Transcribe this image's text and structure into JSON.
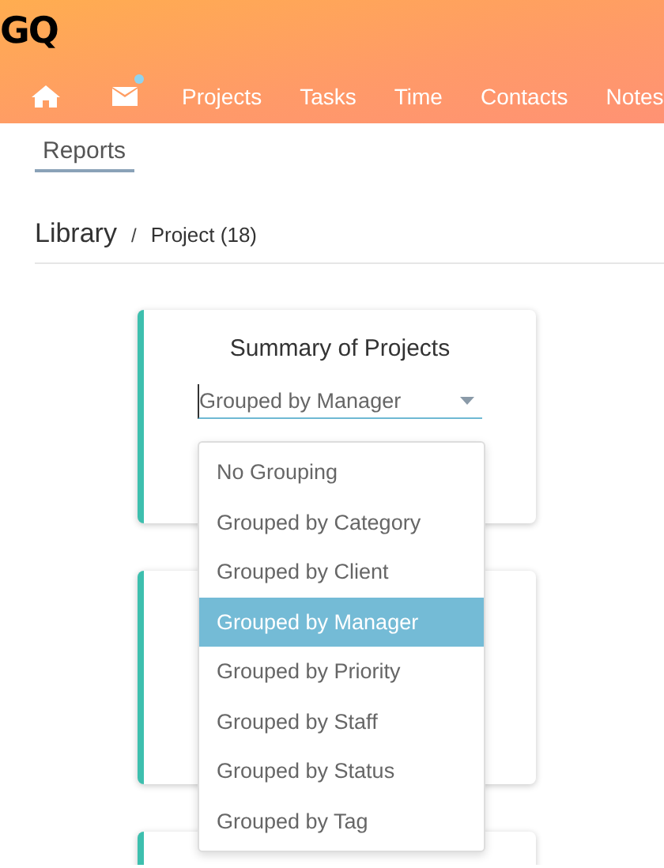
{
  "header": {
    "logo": "GQ",
    "nav": [
      {
        "kind": "home"
      },
      {
        "kind": "mail",
        "unread": true
      },
      {
        "kind": "text",
        "label": "Projects"
      },
      {
        "kind": "text",
        "label": "Tasks"
      },
      {
        "kind": "text",
        "label": "Time"
      },
      {
        "kind": "text",
        "label": "Contacts"
      },
      {
        "kind": "text",
        "label": "Notes"
      }
    ]
  },
  "subtabs": [
    {
      "label": "Reports",
      "selected": true
    }
  ],
  "breadcrumb": {
    "title": "Library",
    "separator": "/",
    "current": "Project (18)"
  },
  "cards": [
    {
      "kind": "report",
      "title": "Summary of Projects",
      "select": {
        "value": "Grouped by Manager",
        "open": true,
        "options": [
          {
            "label": "No Grouping",
            "selected": false
          },
          {
            "label": "Grouped by Category",
            "selected": false
          },
          {
            "label": "Grouped by Client",
            "selected": false
          },
          {
            "label": "Grouped by Manager",
            "selected": true
          },
          {
            "label": "Grouped by Priority",
            "selected": false
          },
          {
            "label": "Grouped by Staff",
            "selected": false
          },
          {
            "label": "Grouped by Status",
            "selected": false
          },
          {
            "label": "Grouped by Tag",
            "selected": false
          }
        ]
      }
    },
    {
      "kind": "report"
    },
    {
      "kind": "report"
    }
  ]
}
